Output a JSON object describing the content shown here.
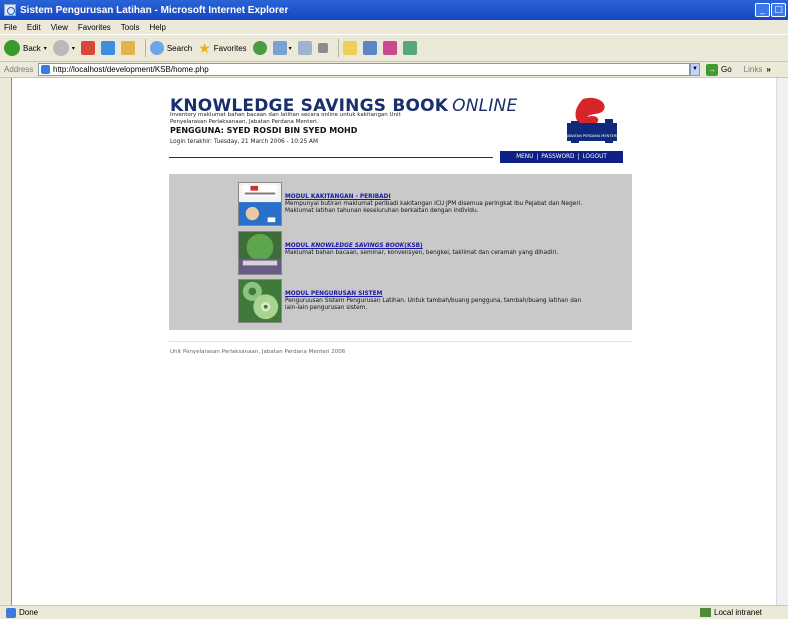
{
  "window": {
    "title": "Sistem Pengurusan Latihan - Microsoft Internet Explorer"
  },
  "menubar": [
    "File",
    "Edit",
    "View",
    "Favorites",
    "Tools",
    "Help"
  ],
  "toolbar": {
    "back_label": "Back",
    "search_label": "Search",
    "favorites_label": "Favorites"
  },
  "addressbar": {
    "label": "Address",
    "url": "http://localhost/development/KSB/home.php",
    "go_label": "Go",
    "links_label": "Links"
  },
  "status": {
    "text": "Done",
    "zone": "Local intranet"
  },
  "page": {
    "brand_main": "KNOWLEDGE SAVINGS BOOK",
    "brand_italic": "ONLINE",
    "description": "Inventory maklumat bahan bacaan dan latihan secara online untuk kakitangan Unit Penyelarasan Perlaksanaan, Jabatan Perdana Menteri.",
    "user_line": "PENGGUNA: SYED ROSDI BIN SYED MOHD",
    "login_line": "Login terakhir: Tuesday, 21 March 2006 - 10:25 AM",
    "nav": {
      "menu": "MENU",
      "password": "PASSWORD",
      "logout": "LOGOUT",
      "sep": "|"
    },
    "logo_text": "JABATAN PERDANA MENTERI",
    "modules": [
      {
        "title": "MODUL KAKITANGAN - PERIBADI",
        "desc": "Mempunyai butiran maklumat peribadi kakitangan ICU JPM disemua peringkat Ibu Pejabat dan Negeri. Maklumat latihan tahunan keseluruhan berkaitan dengan individu."
      },
      {
        "title_prefix": "MODUL ",
        "title_italic": "KNOWLEDGE SAVINGS BOOK",
        "title_suffix": "(KSB)",
        "desc": "Maklumat bahan bacaan, seminar, konvensyen, bengkel, taklimat dan ceramah yang dihadiri."
      },
      {
        "title": "MODUL PENGURUSAN SISTEM",
        "desc": "Penguruusan Sistem Pengurusan Latihan. Untuk tambah/buang pengguna, tambah/buang latihan dan lain-lain pengurusan sistem."
      }
    ],
    "footer": "Unit Penyelarasan Perlaksanaan, Jabatan Perdana Menteri 2006"
  }
}
